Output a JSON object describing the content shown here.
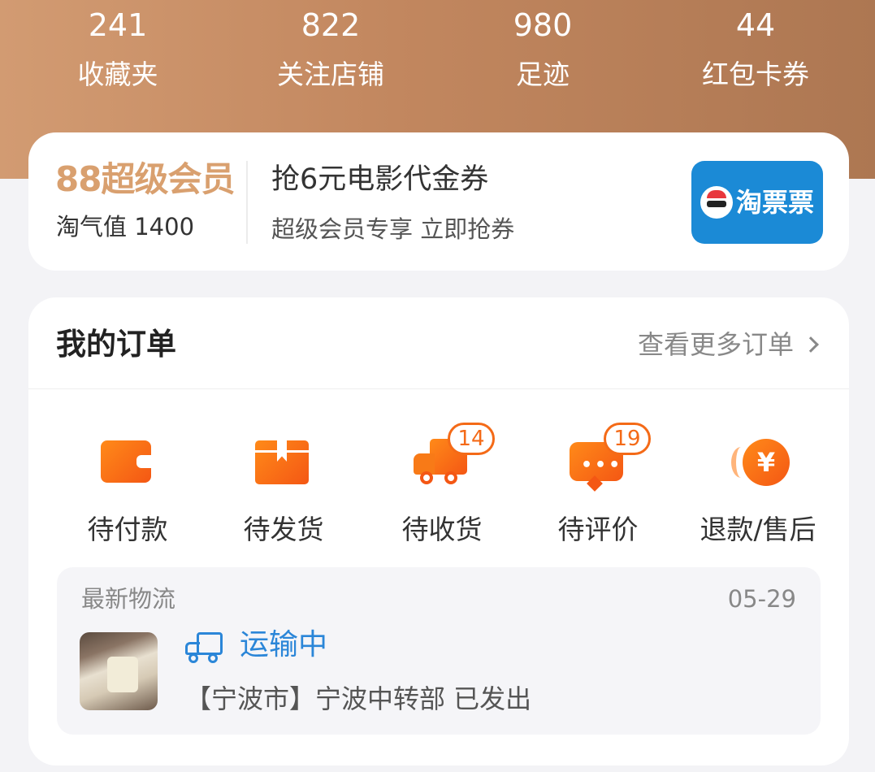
{
  "stats": [
    {
      "value": "241",
      "label": "收藏夹"
    },
    {
      "value": "822",
      "label": "关注店铺"
    },
    {
      "value": "980",
      "label": "足迹"
    },
    {
      "value": "44",
      "label": "红包卡券"
    }
  ],
  "membership": {
    "logo_text": "88超级会员",
    "score_text": "淘气值 1400",
    "promo_title": "抢6元电影代金券",
    "promo_subtitle": "超级会员专享 立即抢券",
    "badge_text": "淘票票"
  },
  "orders": {
    "title": "我的订单",
    "more_label": "查看更多订单",
    "items": [
      {
        "label": "待付款",
        "icon": "wallet-icon",
        "count": null
      },
      {
        "label": "待发货",
        "icon": "box-icon",
        "count": null
      },
      {
        "label": "待收货",
        "icon": "truck-icon",
        "count": "14"
      },
      {
        "label": "待评价",
        "icon": "comment-icon",
        "count": "19"
      },
      {
        "label": "退款/售后",
        "icon": "refund-icon",
        "count": null
      }
    ],
    "logistics": {
      "title": "最新物流",
      "date": "05-29",
      "status": "运输中",
      "detail": "【宁波市】宁波中转部 已发出"
    }
  },
  "colors": {
    "accent": "#f46a17",
    "link_blue": "#2b86d8",
    "member_gold": "#d9a06f",
    "header_start": "#d29b72",
    "header_end": "#ad7752"
  }
}
